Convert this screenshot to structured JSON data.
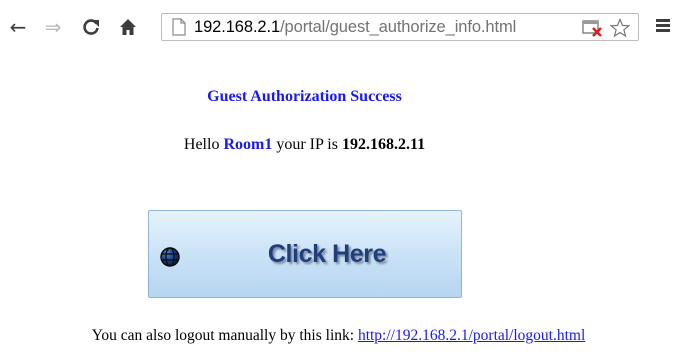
{
  "browser": {
    "url_host": "192.168.2.1",
    "url_path": "/portal/guest_authorize_info.html",
    "icons": {
      "back": "back-arrow-icon",
      "forward": "forward-arrow-icon",
      "reload": "reload-icon",
      "home": "home-icon",
      "page": "page-icon",
      "popup_blocked": "popup-blocked-icon",
      "bookmark": "star-icon",
      "menu": "menu-icon"
    }
  },
  "page": {
    "title": "Guest Authorization Success",
    "greeting_prefix": "Hello ",
    "user_name": "Room1",
    "greeting_middle": " your IP is ",
    "ip_address": "192.168.2.11",
    "button_label": "Click Here",
    "button_icon": "globe-icon",
    "logout_prefix": "You can also logout manually by this link: ",
    "logout_link": "http://192.168.2.1/portal/logout.html"
  },
  "colors": {
    "link_blue": "#1a1aee",
    "title_blue": "#1a1af0",
    "button_text": "#1f3f7a"
  }
}
